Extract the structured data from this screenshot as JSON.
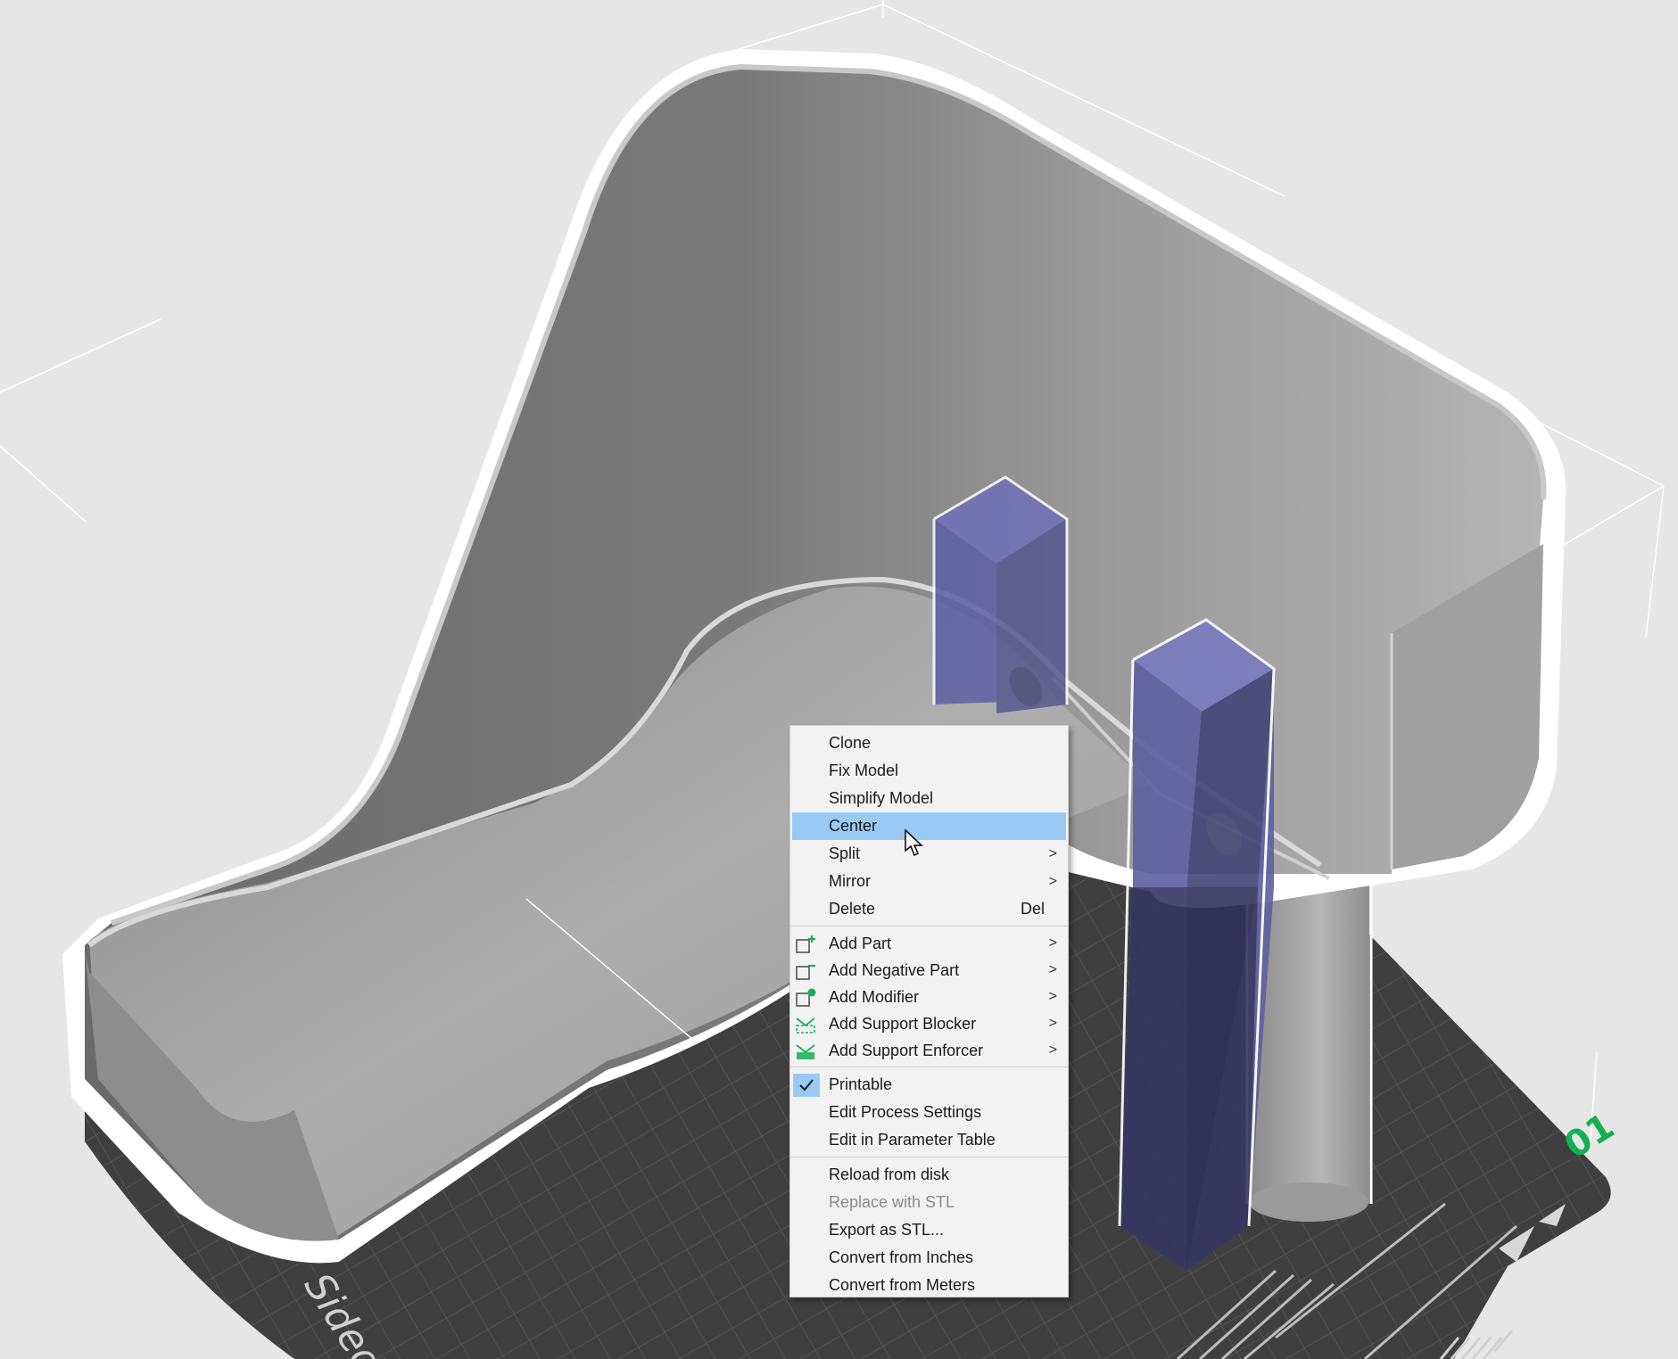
{
  "context_menu": {
    "items": [
      {
        "label": "Clone"
      },
      {
        "label": "Fix Model"
      },
      {
        "label": "Simplify Model"
      },
      {
        "label": "Center",
        "highlighted": true
      },
      {
        "label": "Split",
        "submenu": true
      },
      {
        "label": "Mirror",
        "submenu": true
      },
      {
        "label": "Delete",
        "shortcut": "Del"
      },
      {
        "label": "Add Part",
        "submenu": true,
        "icon": "add-part-icon"
      },
      {
        "label": "Add Negative Part",
        "submenu": true,
        "icon": "add-negative-part-icon"
      },
      {
        "label": "Add Modifier",
        "submenu": true,
        "icon": "add-modifier-icon"
      },
      {
        "label": "Add Support Blocker",
        "submenu": true,
        "icon": "support-blocker-icon"
      },
      {
        "label": "Add Support Enforcer",
        "submenu": true,
        "icon": "support-enforcer-icon"
      },
      {
        "label": "Printable",
        "checked": true
      },
      {
        "label": "Edit Process Settings"
      },
      {
        "label": "Edit in Parameter Table"
      },
      {
        "label": "Reload from disk"
      },
      {
        "label": "Replace with STL",
        "disabled": true
      },
      {
        "label": "Export as STL..."
      },
      {
        "label": "Convert from Inches"
      },
      {
        "label": "Convert from Meters"
      }
    ],
    "submenu_arrow": ">"
  },
  "plate": {
    "label_text": "Sided T",
    "plate_number": "01"
  },
  "colors": {
    "background": "#e6e6e6",
    "model": "#8c8c8c",
    "model_outline": "#ffffff",
    "modifier": "#6f6fb0",
    "bed": "#404040",
    "menu_highlight": "#99c9f5",
    "accent_green": "#15b050"
  }
}
